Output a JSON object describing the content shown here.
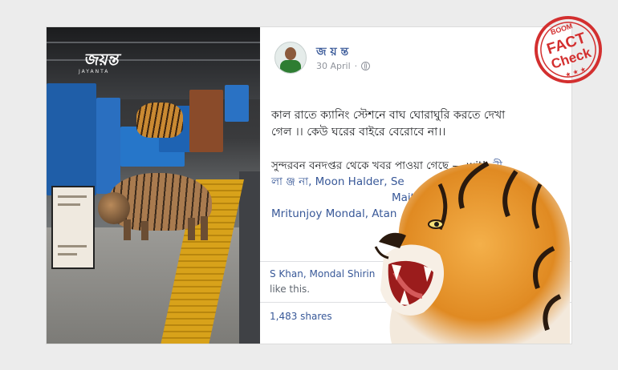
{
  "photo": {
    "brand": "জয়ন্ত",
    "brand_sub": "JAYANTA"
  },
  "post": {
    "author": "জ য় ন্ত",
    "date": "30 April",
    "privacy_icon": "globe-icon",
    "text_line1": "কাল রাতে ক্যানিং স্টেশনে বাঘ ঘোরাঘুরি করতে দেখা",
    "text_line2": "গেল ।। কেউ ঘরের বাইরে বেরোবে না।।",
    "p2_start": "সুন্দরবন বনদপ্তর থেকে খবর পাওয়া গেছে — with ",
    "p2_tag1": "নী",
    "p2_tag1b": "লা ঞ্জ না",
    "p2_tags": ", Moon Halder, Se",
    "p2_tags2": "Maity",
    "p2_tags3": "Mritunjoy Mondal, Atan",
    "reactions_names": "S Khan, Mondal Shirin",
    "reactions_suffix": "like this.",
    "shares": "1,483 shares"
  },
  "stamp": {
    "top": "BOOM",
    "line1": "FACT",
    "line2": "Check",
    "stars": "★ ★ ★"
  },
  "colors": {
    "fb_blue": "#385898",
    "stamp_red": "#d32f2f"
  }
}
